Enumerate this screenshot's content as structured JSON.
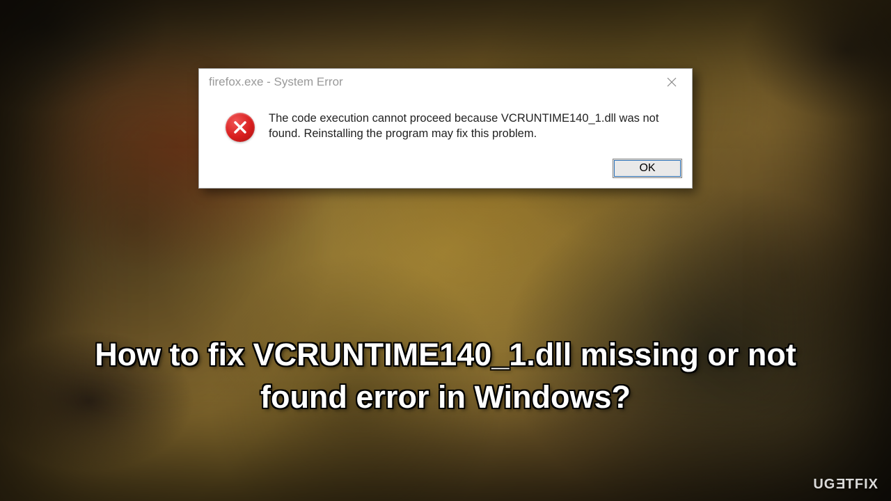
{
  "dialog": {
    "title": "firefox.exe - System Error",
    "message": "The code execution cannot proceed because VCRUNTIME140_1.dll was not found. Reinstalling the program may fix this problem.",
    "ok_label": "OK"
  },
  "headline": {
    "text": "How to fix VCRUNTIME140_1.dll missing or not found error in Windows?"
  },
  "watermark": {
    "brand_pre": "UG",
    "brand_flip": "E",
    "brand_post": "TFIX"
  }
}
